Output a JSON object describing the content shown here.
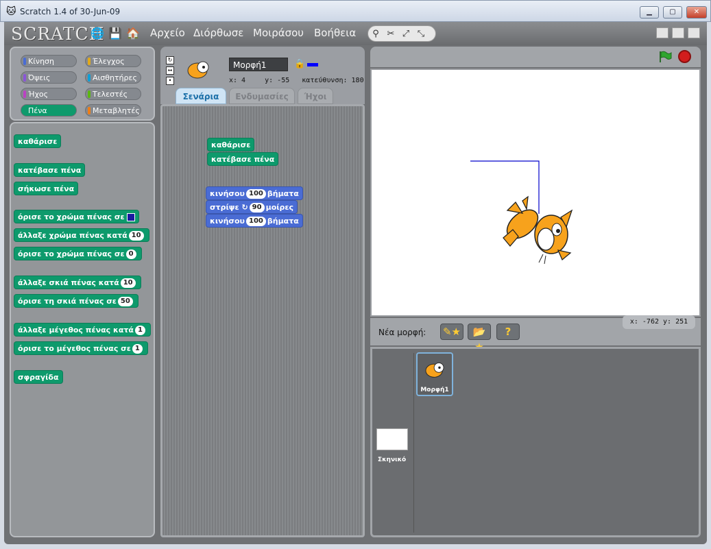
{
  "window": {
    "title": "Scratch 1.4 of 30-Jun-09",
    "buttons": [
      "▁",
      "▢",
      "✕"
    ]
  },
  "menubar": {
    "logo": "SCRATCH",
    "menus": [
      "Αρχείο",
      "Διόρθωσε",
      "Μοιράσου",
      "Βοήθεια"
    ],
    "tools": [
      "⚲",
      "✂",
      "⤢",
      "⤡"
    ]
  },
  "categories": [
    {
      "label": "Κίνηση",
      "color": "#4a6cd4"
    },
    {
      "label": "Έλεγχος",
      "color": "#e1a91a"
    },
    {
      "label": "Όψεις",
      "color": "#8a55d7"
    },
    {
      "label": "Αισθητήρες",
      "color": "#0d9fd8"
    },
    {
      "label": "Ήχος",
      "color": "#bb42c3"
    },
    {
      "label": "Τελεστές",
      "color": "#5cb712"
    },
    {
      "label": "Πένα",
      "color": "#0e9a6c"
    },
    {
      "label": "Μεταβλητές",
      "color": "#ee7d16"
    }
  ],
  "palette_blocks": [
    {
      "text": "καθάρισε"
    },
    {
      "text": "κατέβασε πένα"
    },
    {
      "text": "σήκωσε πένα"
    },
    {
      "text": "όρισε το χρώμα πένας σε",
      "swatch": "#1a1aa0"
    },
    {
      "text": "άλλαξε χρώμα πένας κατά",
      "num": "10"
    },
    {
      "text": "όρισε το χρώμα πένας σε",
      "num": "0"
    },
    {
      "text": "άλλαξε σκιά πένας κατά",
      "num": "10"
    },
    {
      "text": "όρισε τη σκιά πένας σε",
      "num": "50"
    },
    {
      "text": "άλλαξε μέγεθος πένας κατά",
      "num": "1"
    },
    {
      "text": "όρισε το μέγεθος πένας σε",
      "num": "1"
    },
    {
      "text": "σφραγίδα"
    }
  ],
  "sprite": {
    "name": "Μορφή1",
    "x_label": "x: 4",
    "y_label": "y: -55",
    "direction_label": "κατεύθυνση: 180",
    "pen_color": "#0000ff"
  },
  "tabs": [
    "Σενάρια",
    "Ενδυμασίες",
    "Ήχοι"
  ],
  "script": {
    "block1": "καθάρισε",
    "block2": "κατέβασε πένα",
    "move1_pre": "κινήσου",
    "move1_num": "100",
    "move1_post": "βήματα",
    "turn_pre": "στρίψε",
    "turn_icon": "↻",
    "turn_num": "90",
    "turn_post": "μοίρες",
    "move2_pre": "κινήσου",
    "move2_num": "100",
    "move2_post": "βήματα"
  },
  "stage": {
    "new_sprite_label": "Νέα μορφή:",
    "new_sprite_buttons": [
      "✎★",
      "📂★",
      "?"
    ],
    "mouse_xy": "x: -762   y: 251",
    "background_label": "Σκηνικό"
  }
}
